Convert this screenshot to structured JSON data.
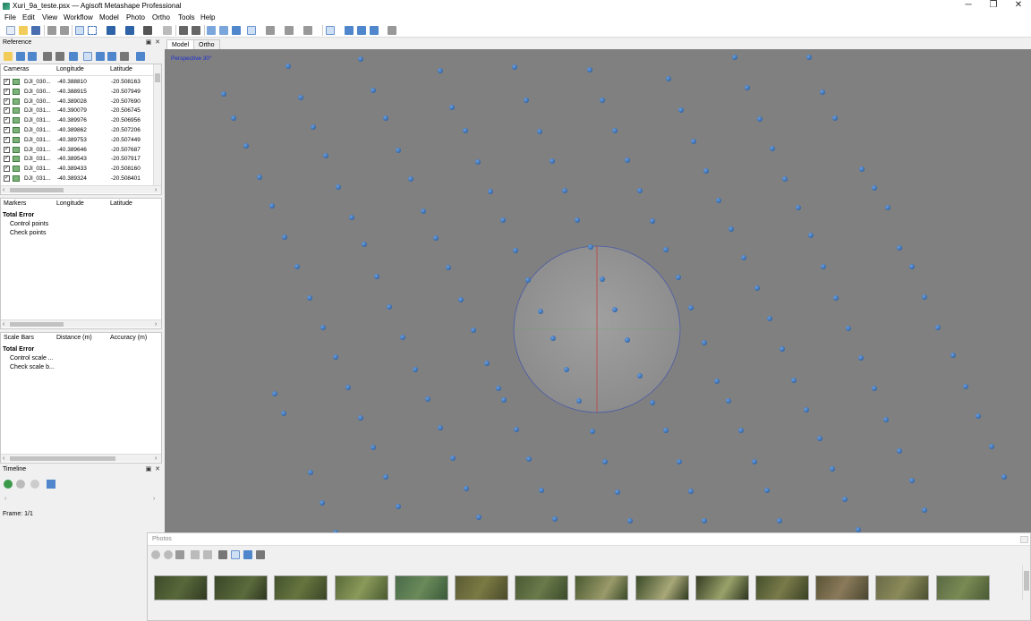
{
  "window": {
    "title": "Xuri_9a_teste.psx — Agisoft Metashape Professional",
    "controls": [
      "─",
      "❐",
      "✕"
    ]
  },
  "menu": [
    "File",
    "Edit",
    "View",
    "Workflow",
    "Model",
    "Photo",
    "Ortho",
    "Tools",
    "Help"
  ],
  "reference": {
    "title": "Reference",
    "cameras_header": {
      "name": "Cameras",
      "lon": "Longitude",
      "lat": "Latitude"
    },
    "cameras": [
      {
        "name": "DJI_030...",
        "lon": "-40.388810",
        "lat": "-20.508163"
      },
      {
        "name": "DJI_030...",
        "lon": "-40.388915",
        "lat": "-20.507949"
      },
      {
        "name": "DJI_030...",
        "lon": "-40.389028",
        "lat": "-20.507690"
      },
      {
        "name": "DJI_031...",
        "lon": "-40.390079",
        "lat": "-20.506745"
      },
      {
        "name": "DJI_031...",
        "lon": "-40.389976",
        "lat": "-20.506956"
      },
      {
        "name": "DJI_031...",
        "lon": "-40.389862",
        "lat": "-20.507206"
      },
      {
        "name": "DJI_031...",
        "lon": "-40.389753",
        "lat": "-20.507449"
      },
      {
        "name": "DJI_031...",
        "lon": "-40.389646",
        "lat": "-20.507687"
      },
      {
        "name": "DJI_031...",
        "lon": "-40.389543",
        "lat": "-20.507917"
      },
      {
        "name": "DJI_031...",
        "lon": "-40.389433",
        "lat": "-20.508160"
      },
      {
        "name": "DJI_031...",
        "lon": "-40.389324",
        "lat": "-20.508401"
      }
    ],
    "markers_header": {
      "name": "Markers",
      "lon": "Longitude",
      "lat": "Latitude"
    },
    "markers_total": "Total Error",
    "markers_items": [
      "Control points",
      "Check points"
    ],
    "scalebars_header": {
      "name": "Scale Bars",
      "dist": "Distance (m)",
      "acc": "Accuracy (m)"
    },
    "scalebars_total": "Total Error",
    "scalebars_items": [
      "Control scale ...",
      "Check scale b..."
    ]
  },
  "timeline": {
    "title": "Timeline",
    "frame": "Frame: 1/1"
  },
  "view": {
    "tabs": [
      "Model",
      "Ortho"
    ],
    "active_tab": "Model",
    "label": "Perspective 30°"
  },
  "photos": {
    "title": "Photos",
    "thumb_count": 14
  },
  "colors": {
    "viewport_bg": "#808080",
    "camera_dot": "#2f63a8",
    "view_label": "#1a2bd6"
  }
}
